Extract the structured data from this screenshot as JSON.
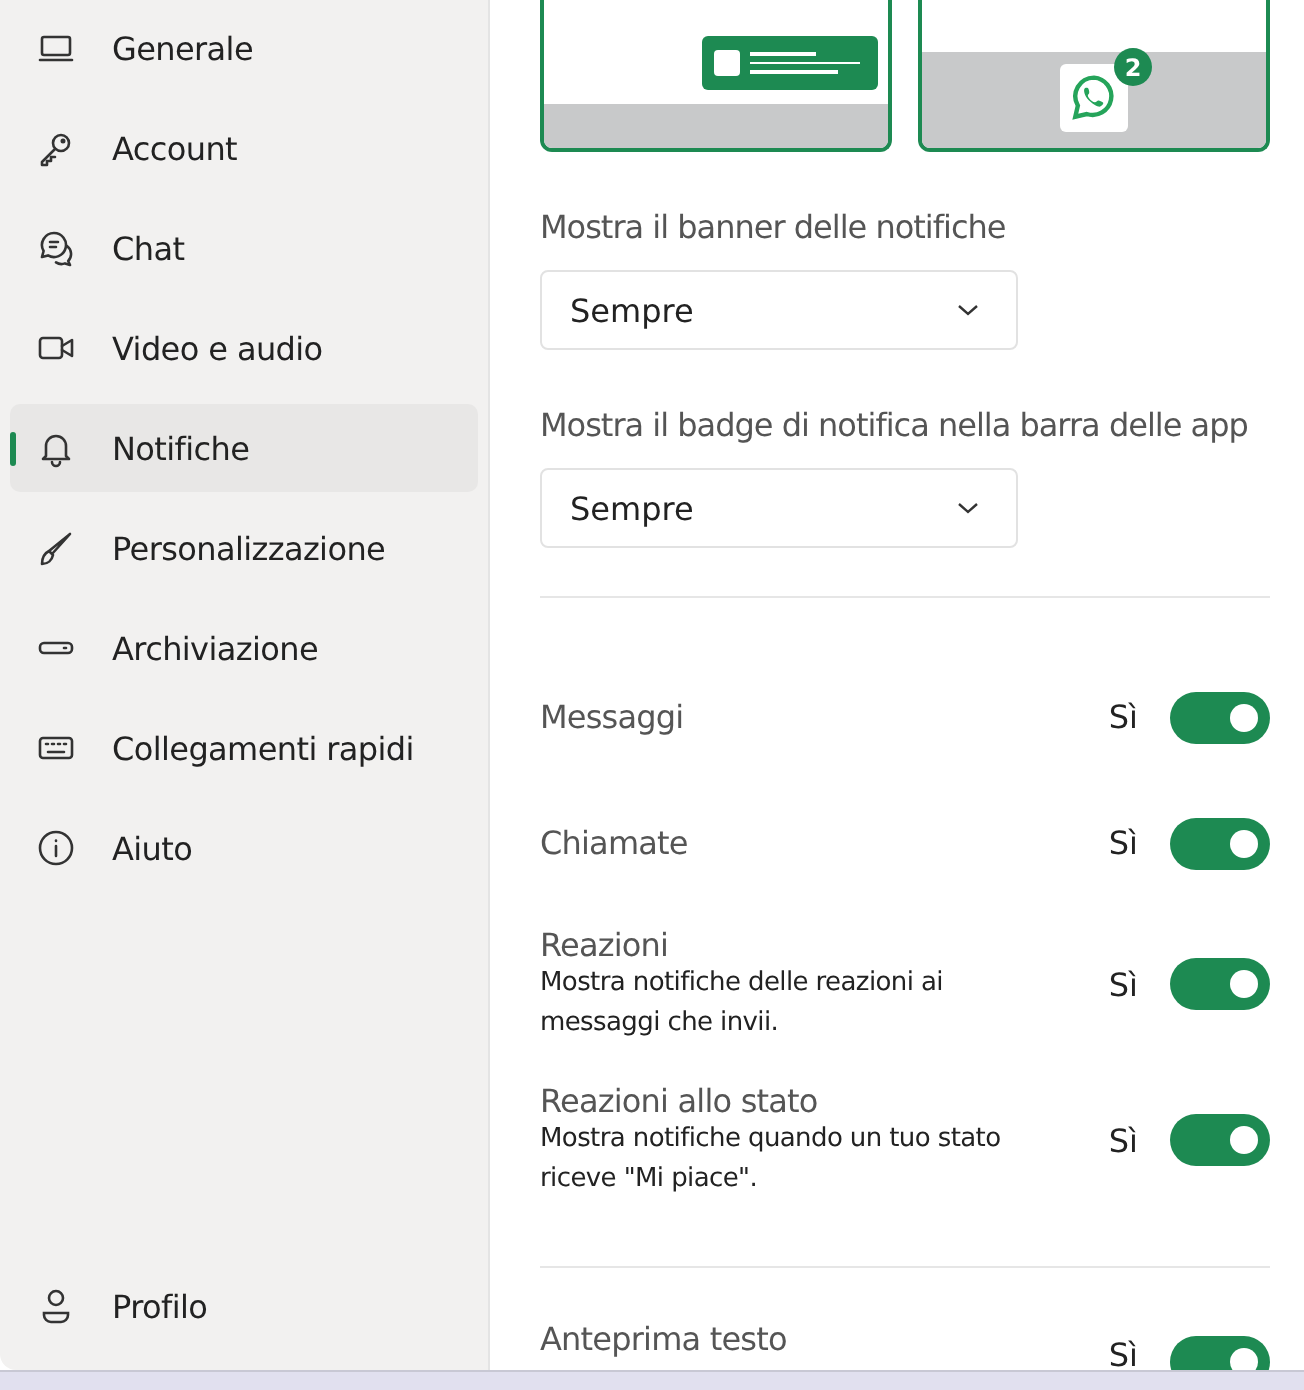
{
  "sidebar": {
    "items": [
      {
        "label": "Generale",
        "selected": false
      },
      {
        "label": "Account",
        "selected": false
      },
      {
        "label": "Chat",
        "selected": false
      },
      {
        "label": "Video e audio",
        "selected": false
      },
      {
        "label": "Notifiche",
        "selected": true
      },
      {
        "label": "Personalizzazione",
        "selected": false
      },
      {
        "label": "Archiviazione",
        "selected": false
      },
      {
        "label": "Collegamenti rapidi",
        "selected": false
      },
      {
        "label": "Aiuto",
        "selected": false
      }
    ],
    "footer": {
      "label": "Profilo"
    }
  },
  "previews": [
    {
      "kind": "banner"
    },
    {
      "kind": "badge",
      "badge": "2"
    }
  ],
  "dropdowns": [
    {
      "label": "Mostra il banner delle notifiche",
      "value": "Sempre"
    },
    {
      "label": "Mostra il badge di notifica nella barra delle app",
      "value": "Sempre"
    }
  ],
  "toggles": [
    {
      "title": "Messaggi",
      "state_label": "Sì",
      "on": true
    },
    {
      "title": "Chiamate",
      "state_label": "Sì",
      "on": true
    },
    {
      "title": "Reazioni",
      "description": "Mostra notifiche delle reazioni ai messaggi che invii.",
      "state_label": "Sì",
      "on": true
    },
    {
      "title": "Reazioni allo stato",
      "description": "Mostra notifiche quando un tuo stato riceve \"Mi piace\".",
      "state_label": "Sì",
      "on": true
    }
  ],
  "toggles_2": [
    {
      "title": "Anteprima testo",
      "state_label": "Sì",
      "on": true
    }
  ]
}
